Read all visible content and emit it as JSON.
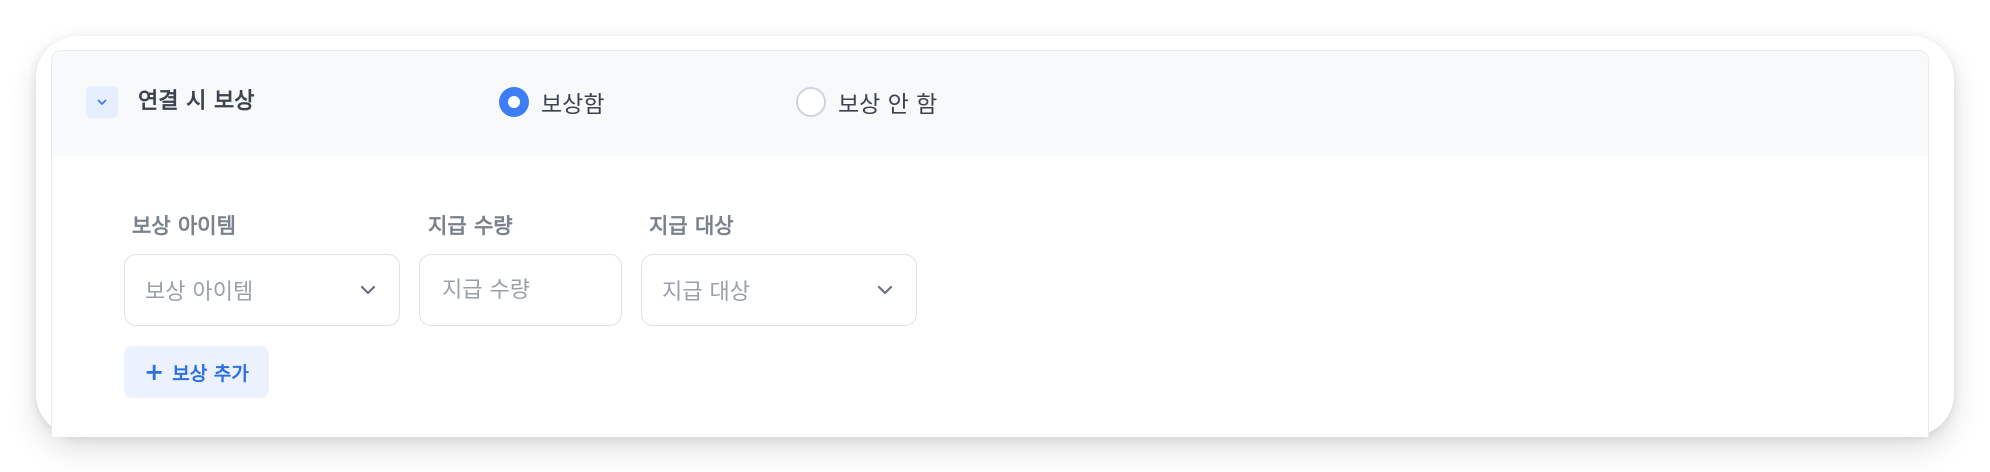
{
  "section": {
    "title": "연결 시 보상",
    "collapse_icon": "chevron-down-icon"
  },
  "reward_mode": {
    "options": [
      {
        "label": "보상함",
        "selected": true
      },
      {
        "label": "보상 안 함",
        "selected": false
      }
    ]
  },
  "reward_form": {
    "item": {
      "label": "보상 아이템",
      "placeholder": "보상 아이템"
    },
    "quantity": {
      "label": "지급 수량",
      "placeholder": "지급 수량",
      "value": ""
    },
    "target": {
      "label": "지급 대상",
      "placeholder": "지급 대상"
    }
  },
  "add_reward": {
    "icon": "plus-icon",
    "label": "보상 추가"
  },
  "colors": {
    "accent": "#3d7ef6",
    "accent_text": "#2f6fe4",
    "accent_bg": "#ebf2fe",
    "header_bg": "#f8f9fa",
    "label_text": "#7a828e",
    "body_text": "#3c4350",
    "placeholder": "#9aa0aa"
  }
}
